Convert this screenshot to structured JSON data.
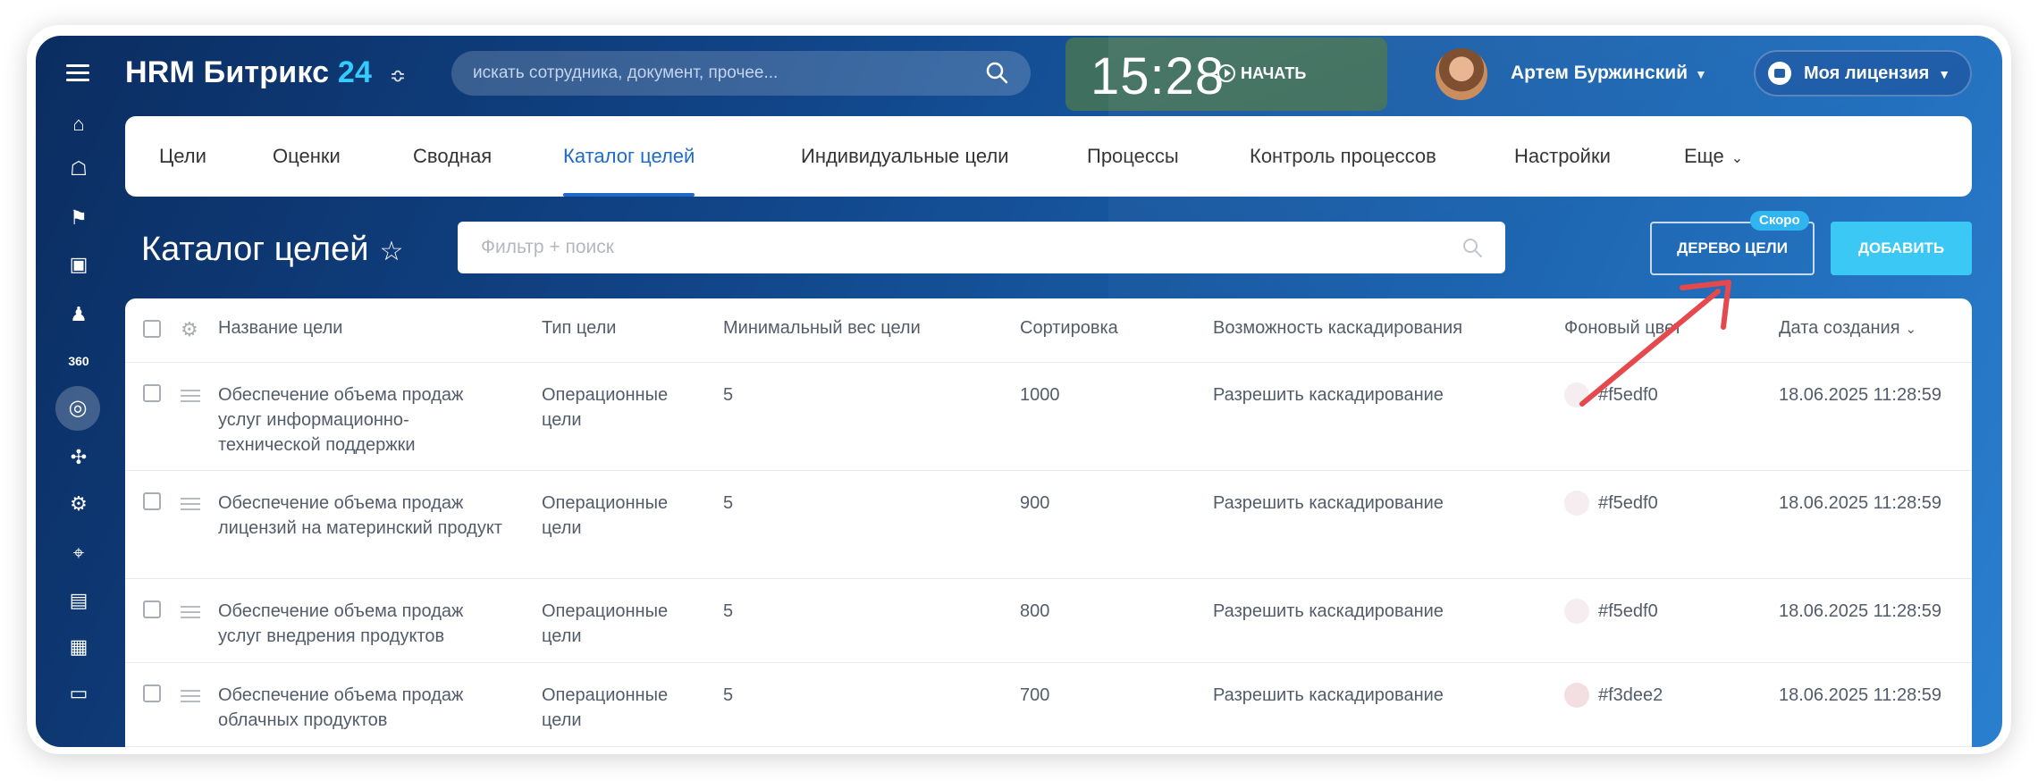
{
  "brand": {
    "name": "HRM Битрикс",
    "number": "24",
    "settings_icon": "≎"
  },
  "search": {
    "placeholder": "искать сотрудника, документ, прочее..."
  },
  "clock": {
    "time": "15:28",
    "start_label": "НАЧАТЬ"
  },
  "user": {
    "name": "Артем Буржинский"
  },
  "license": {
    "label": "Моя лицензия"
  },
  "tabs": [
    {
      "label": "Цели"
    },
    {
      "label": "Оценки"
    },
    {
      "label": "Сводная"
    },
    {
      "label": "Каталог целей"
    },
    {
      "label": "Индивидуальные цели"
    },
    {
      "label": "Процессы"
    },
    {
      "label": "Контроль процессов"
    },
    {
      "label": "Настройки"
    },
    {
      "label": "Еще"
    }
  ],
  "page": {
    "title": "Каталог целей",
    "filter_placeholder": "Фильтр + поиск"
  },
  "buttons": {
    "tree": "ДЕРЕВО ЦЕЛИ",
    "soon_badge": "Скоро",
    "add": "ДОБАВИТЬ"
  },
  "table": {
    "columns": {
      "name": "Название цели",
      "type": "Тип цели",
      "min_weight": "Минимальный вес цели",
      "sort": "Сортировка",
      "cascade": "Возможность каскадирования",
      "bg_color": "Фоновый цвет",
      "created": "Дата создания"
    },
    "rows": [
      {
        "name": "Обеспечение объема продаж услуг информационно-технической поддержки",
        "type": "Операционные цели",
        "min_weight": "5",
        "sort": "1000",
        "cascade": "Разрешить каскадирование",
        "bg_color": "#f5edf0",
        "created": "18.06.2025 11:28:59"
      },
      {
        "name": "Обеспечение объема продаж лицензий на материнский продукт",
        "type": "Операционные цели",
        "min_weight": "5",
        "sort": "900",
        "cascade": "Разрешить каскадирование",
        "bg_color": "#f5edf0",
        "created": "18.06.2025 11:28:59"
      },
      {
        "name": "Обеспечение объема продаж услуг внедрения продуктов",
        "type": "Операционные цели",
        "min_weight": "5",
        "sort": "800",
        "cascade": "Разрешить каскадирование",
        "bg_color": "#f5edf0",
        "created": "18.06.2025 11:28:59"
      },
      {
        "name": "Обеспечение объема продаж облачных продуктов",
        "type": "Операционные цели",
        "min_weight": "5",
        "sort": "700",
        "cascade": "Разрешить каскадирование",
        "bg_color": "#f3dee2",
        "created": "18.06.2025 11:28:59"
      }
    ]
  },
  "colors": {
    "accent": "#1e6bc6",
    "add_button": "#3bc8f5",
    "annotation_arrow": "#e5484d"
  }
}
